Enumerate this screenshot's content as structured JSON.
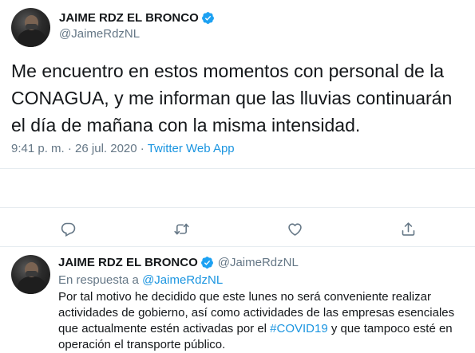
{
  "main_tweet": {
    "display_name": "JAIME RDZ EL BRONCO",
    "handle": "@JaimeRdzNL",
    "text": "Me encuentro en estos momentos con personal de la CONAGUA, y me informan que las lluvias continuarán el día de mañana con la misma intensidad.",
    "time": "9:41 p. m.",
    "separator1": " · ",
    "date": "26 jul. 2020",
    "separator2": " · ",
    "source": "Twitter Web App",
    "verified_icon": "verified-badge-icon",
    "actions": [
      "reply-icon",
      "retweet-icon",
      "like-icon",
      "share-icon"
    ]
  },
  "reply_tweet": {
    "display_name": "JAIME RDZ EL BRONCO",
    "handle": "@JaimeRdzNL",
    "reply_prefix": "En respuesta a ",
    "reply_mention": "@JaimeRdzNL",
    "text_part1": "Por tal motivo he decidido que este lunes no será conveniente realizar actividades de gobierno, así como actividades de las empresas esenciales que actualmente estén activadas por el ",
    "hashtag": "#COVID19",
    "text_part2": " y que tampoco esté en operación el transporte público."
  },
  "colors": {
    "text": "#14171a",
    "secondary": "#657786",
    "link": "#1b95e0",
    "divider": "#e6ecf0",
    "verified": "#1da1f2"
  }
}
